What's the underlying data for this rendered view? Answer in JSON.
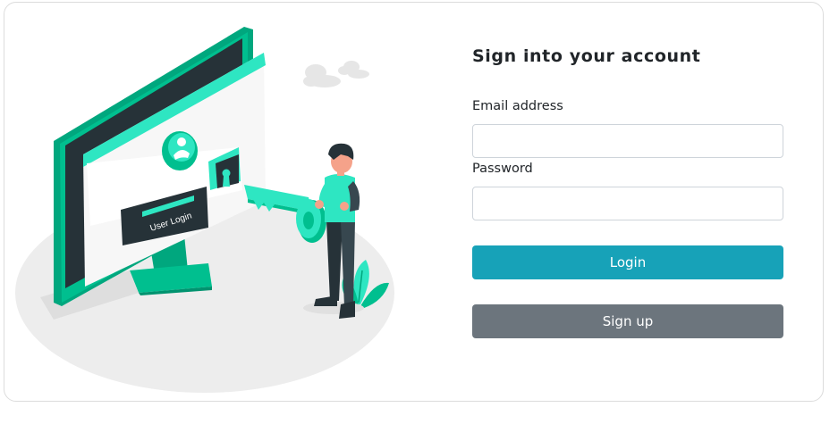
{
  "form": {
    "title": "Sign into your account",
    "email_label": "Email address",
    "email_value": "",
    "email_placeholder": "",
    "password_label": "Password",
    "password_value": "",
    "password_placeholder": "",
    "login_label": "Login",
    "signup_label": "Sign up"
  },
  "illustration": {
    "screen_button_text": "User Login",
    "icons": [
      "user-avatar-icon",
      "keyhole-icon",
      "key-icon",
      "cloud-icon",
      "plant-icon"
    ]
  },
  "colors": {
    "accent_green": "#00bf8f",
    "accent_mint": "#2ee6c2",
    "dark_slate": "#263238",
    "login_button": "#17a2b8",
    "signup_button": "#6c757d",
    "card_border": "#dcdcdc"
  }
}
